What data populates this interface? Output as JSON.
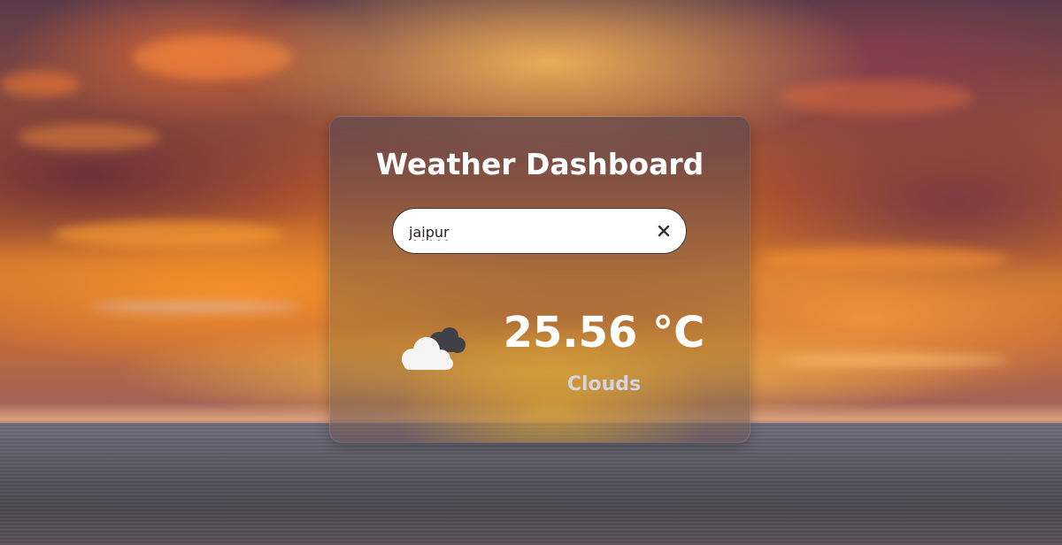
{
  "app": {
    "title": "Weather Dashboard"
  },
  "search": {
    "value": "jaipur",
    "clear_icon": "close-icon"
  },
  "weather": {
    "icon": "cloud-icon",
    "temperature": "25.56 °C",
    "condition": "Clouds"
  },
  "colors": {
    "title_text": "#ffffff",
    "condition_text": "#d4d4dc",
    "search_bg": "#ffffff"
  }
}
